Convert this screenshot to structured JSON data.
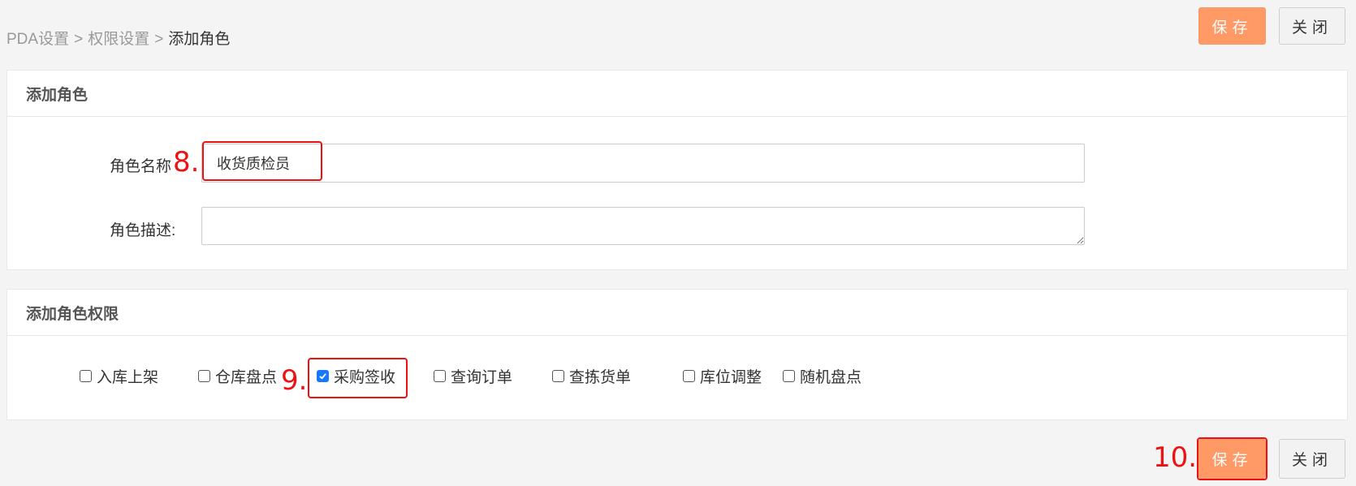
{
  "breadcrumb": {
    "items": [
      "PDA设置",
      "权限设置"
    ],
    "separator": ">",
    "current": "添加角色"
  },
  "toolbar": {
    "save_label": "保存",
    "close_label": "关闭"
  },
  "role_panel": {
    "title": "添加角色",
    "name_label": "角色名称",
    "name_value": "收货质检员",
    "desc_label": "角色描述:",
    "desc_value": ""
  },
  "permission_panel": {
    "title": "添加角色权限",
    "items": [
      {
        "label": "入库上架",
        "checked": false
      },
      {
        "label": "仓库盘点",
        "checked": false
      },
      {
        "label": "采购签收",
        "checked": true
      },
      {
        "label": "查询订单",
        "checked": false
      },
      {
        "label": "查拣货单",
        "checked": false
      },
      {
        "label": "库位调整",
        "checked": false
      },
      {
        "label": "随机盘点",
        "checked": false
      }
    ]
  },
  "annotations": {
    "step8": "8.",
    "step9": "9.",
    "step10": "10.",
    "color": "#ee1111"
  },
  "colors": {
    "accent": "#ff9966",
    "checkbox_checked": "#1677ff"
  }
}
